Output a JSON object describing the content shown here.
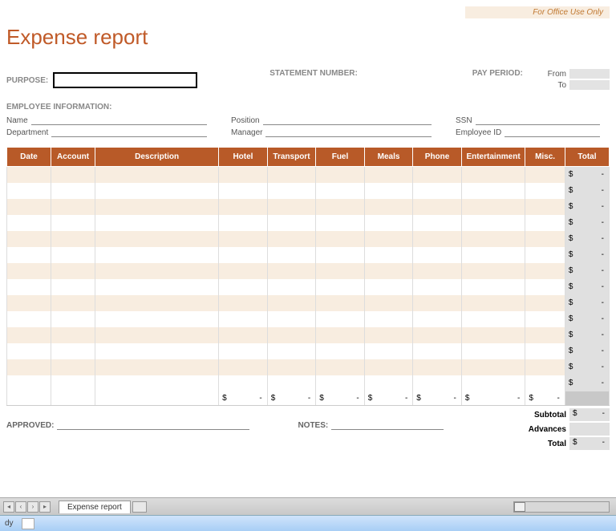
{
  "office_use": "For Office Use Only",
  "title": "Expense report",
  "labels": {
    "purpose": "PURPOSE:",
    "statement": "STATEMENT NUMBER:",
    "pay_period": "PAY PERIOD:",
    "from": "From",
    "to": "To",
    "emp_info": "EMPLOYEE INFORMATION:",
    "name": "Name",
    "position": "Position",
    "ssn": "SSN",
    "department": "Department",
    "manager": "Manager",
    "employee_id": "Employee ID",
    "approved": "APPROVED:",
    "notes": "NOTES:",
    "subtotal": "Subtotal",
    "advances": "Advances",
    "total": "Total"
  },
  "columns": [
    "Date",
    "Account",
    "Description",
    "Hotel",
    "Transport",
    "Fuel",
    "Meals",
    "Phone",
    "Entertainment",
    "Misc.",
    "Total"
  ],
  "currency": "$",
  "dash": "-",
  "row_count": 14,
  "tab": {
    "name": "Expense report",
    "status": "dy"
  }
}
